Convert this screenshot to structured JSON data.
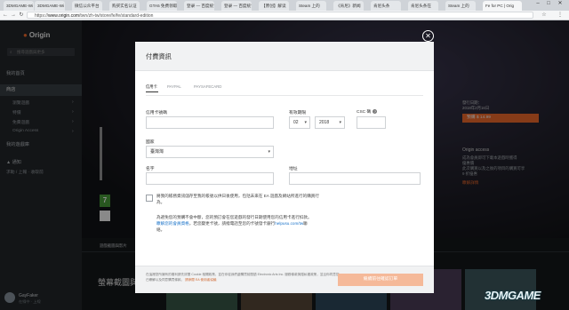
{
  "browser": {
    "tabs": [
      "3DMGAME-Wi",
      "3DMGAME-Wi",
      "微信公众平台",
      "购买实名认证",
      "GTA5 免费领取",
      "登录 — 百度统计",
      "登录 — 百度统计",
      "【原创】解读",
      "Steam 上的",
      "《肯尼》新闻",
      "肯尼头条",
      "肯尼头条在",
      "Steam 上的",
      "Fe for PC | Orig"
    ],
    "active_tab_index": 13,
    "url_prefix": "https://",
    "url_domain": "www.origin.com",
    "url_path": "/twn/zh-tw/store/fe/fe/standard-edition"
  },
  "sidebar": {
    "logo": "Origin",
    "search_placeholder": "搜尋遊戲與更多",
    "items": [
      {
        "label": "我的首頁"
      },
      {
        "label": "商店"
      },
      {
        "label": "瀏覽遊戲"
      },
      {
        "label": "特價"
      },
      {
        "label": "免費遊戲"
      },
      {
        "label": "Origin Access"
      },
      {
        "label": "我的遊戲庫"
      },
      {
        "label": "通知"
      },
      {
        "label": "求助 / 上報 · 收取前"
      }
    ],
    "user": {
      "name": "GayFaker",
      "status": "在線中 · 上線"
    }
  },
  "store": {
    "release_label": "發行日期：",
    "release_value": "2018年2月16日",
    "buy_label": "預購 $ 14.99",
    "origin_label": "Origin access",
    "origin_desc": [
      "成為會員即可下載本遊戲時獲得",
      "優惠價",
      "此次購買以及之後的項目的購買可享",
      "9 折優惠"
    ],
    "learn_more": "瞭解詳情",
    "tab_label": "遊戲截圖與影片",
    "gallery_title": "螢幕截圖與影片",
    "rating": "7",
    "watermark": "3DMGAME"
  },
  "modal": {
    "title": "付費資訊",
    "close_glyph": "✕",
    "tabs": [
      "信用卡",
      "PAYPAL",
      "PAYSAFECARD"
    ],
    "labels": {
      "card_number": "信用卡號碼",
      "expiry": "有效期限",
      "csc": "CSC 碼",
      "country": "國家",
      "name": "名字",
      "address": "地址"
    },
    "values": {
      "expiry_month": "02",
      "expiry_year": "2018",
      "country": "臺灣灣"
    },
    "save_card_text": "將我的帳務資訊儲存至我的帳號以供日後使用，包括未來在 EA 遊戲及網站所進行的購買行為。",
    "note_text": "為避免您的預購不會中斷，您的預訂會在您遊戲的發行日期使用您的信用卡進行扣款。",
    "note_link": "瞭解您的會員資格",
    "note_mid": "，若您變更卡號，請撥電話至您的卡號發卡銀行",
    "note_link2": "helpusu.com/tw",
    "note_end": "聯絡。",
    "footer_text": "在這裡您所擁有的權利請先詳閱 Cookie 相關政策、並在你從我們處購買前閱讀 Electronic Arts Inc. 服務條款與隱私權政策，並且你同意您已瞭解以及同意購買條款。",
    "footer_link": "請參閱 EA 使用者協議",
    "submit_label": "繼續前往確認訂單"
  }
}
